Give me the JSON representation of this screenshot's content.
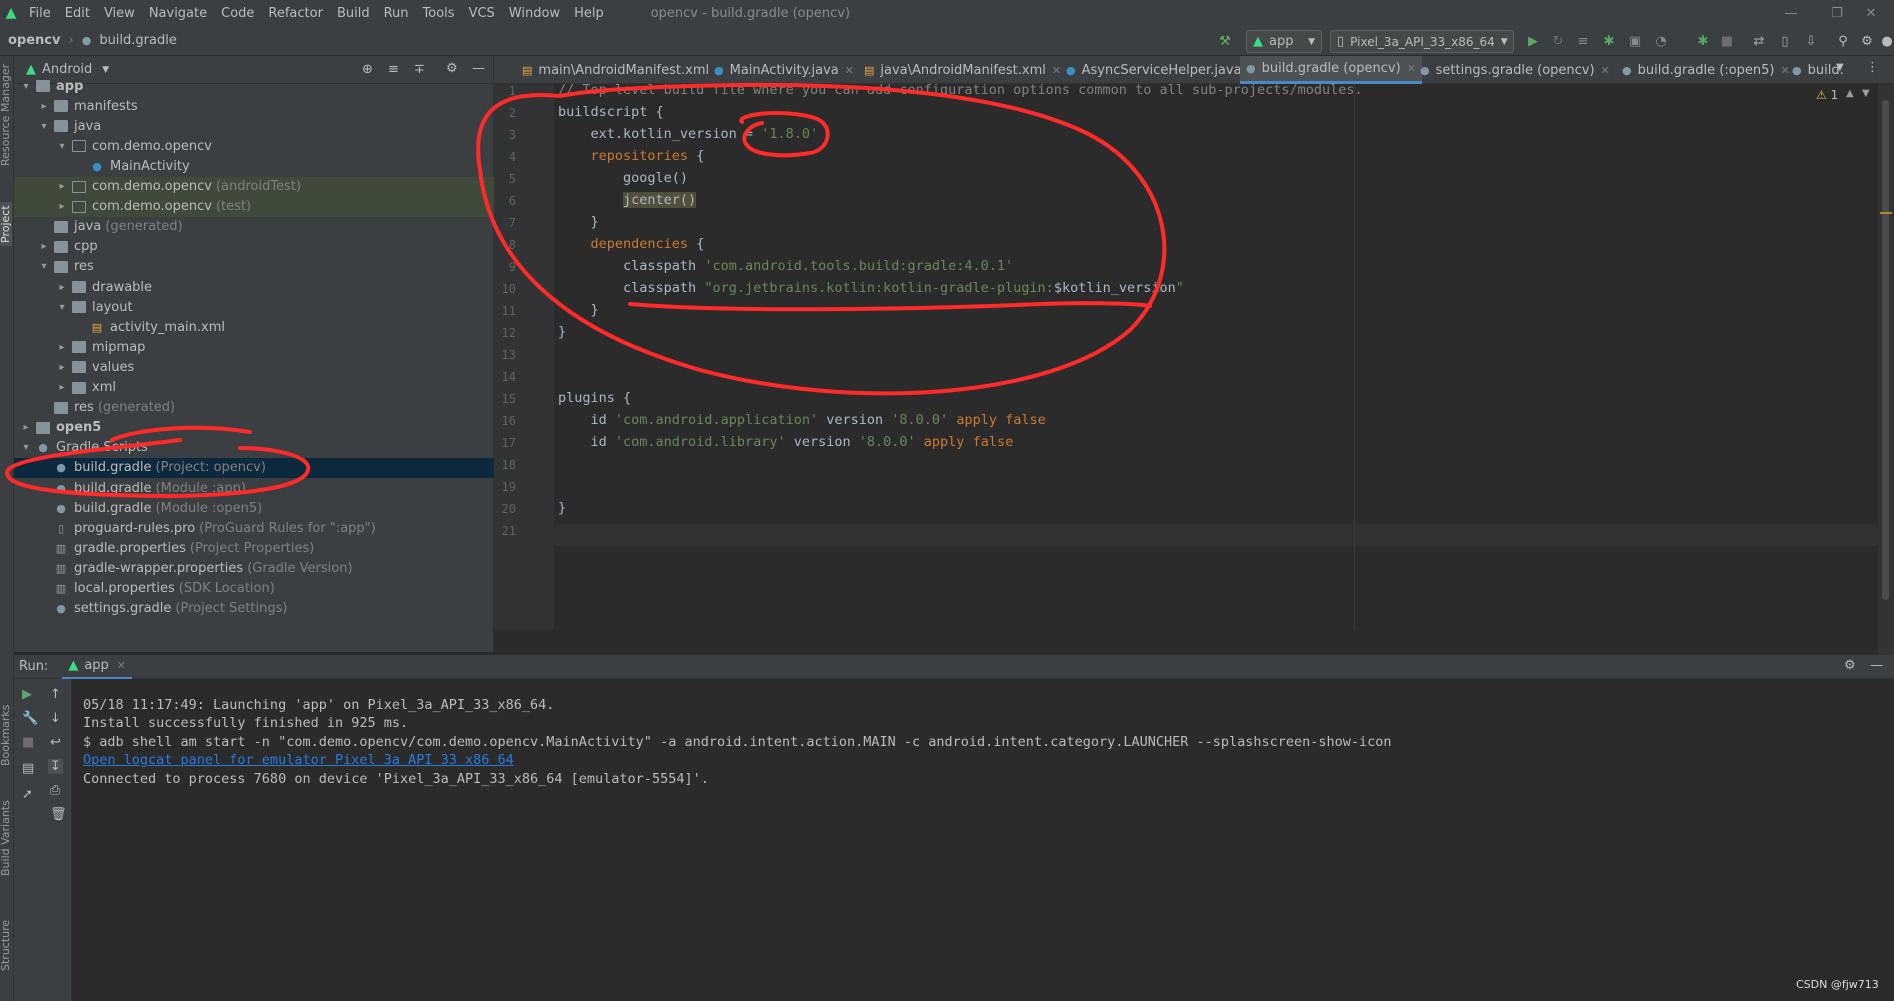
{
  "app": {
    "logo_icon": "android-studio-icon",
    "window_title": "opencv - build.gradle (opencv)"
  },
  "menu": [
    "File",
    "Edit",
    "View",
    "Navigate",
    "Code",
    "Refactor",
    "Build",
    "Run",
    "Tools",
    "VCS",
    "Window",
    "Help"
  ],
  "breadcrumb": {
    "project": "opencv",
    "file": "build.gradle"
  },
  "toolbar": {
    "run_config": "app",
    "device": "Pixel_3a_API_33_x86_64"
  },
  "left_stripe": {
    "resource_manager": "Resource Manager",
    "project": "Project",
    "bookmarks": "Bookmarks",
    "build_variants": "Build Variants",
    "structure": "Structure"
  },
  "project_panel": {
    "view_label": "Android",
    "tree": [
      {
        "label": "app",
        "suffix": "",
        "depth": 0,
        "expanded": true,
        "icon": "folder",
        "bold": true
      },
      {
        "label": "manifests",
        "suffix": "",
        "depth": 1,
        "expanded": false,
        "icon": "folder"
      },
      {
        "label": "java",
        "suffix": "",
        "depth": 1,
        "expanded": true,
        "icon": "folder"
      },
      {
        "label": "com.demo.opencv",
        "suffix": "",
        "depth": 2,
        "expanded": true,
        "icon": "package"
      },
      {
        "label": "MainActivity",
        "suffix": "",
        "depth": 3,
        "icon": "class"
      },
      {
        "label": "com.demo.opencv",
        "suffix": "(androidTest)",
        "depth": 2,
        "expanded": false,
        "icon": "package",
        "highlight": true
      },
      {
        "label": "com.demo.opencv",
        "suffix": "(test)",
        "depth": 2,
        "expanded": false,
        "icon": "package",
        "highlight": true
      },
      {
        "label": "java",
        "suffix": "(generated)",
        "depth": 1,
        "icon": "folder"
      },
      {
        "label": "cpp",
        "suffix": "",
        "depth": 1,
        "expanded": false,
        "icon": "folder"
      },
      {
        "label": "res",
        "suffix": "",
        "depth": 1,
        "expanded": true,
        "icon": "folder"
      },
      {
        "label": "drawable",
        "suffix": "",
        "depth": 2,
        "expanded": false,
        "icon": "folder"
      },
      {
        "label": "layout",
        "suffix": "",
        "depth": 2,
        "expanded": true,
        "icon": "folder"
      },
      {
        "label": "activity_main.xml",
        "suffix": "",
        "depth": 3,
        "icon": "xml"
      },
      {
        "label": "mipmap",
        "suffix": "",
        "depth": 2,
        "expanded": false,
        "icon": "folder"
      },
      {
        "label": "values",
        "suffix": "",
        "depth": 2,
        "expanded": false,
        "icon": "folder"
      },
      {
        "label": "xml",
        "suffix": "",
        "depth": 2,
        "expanded": false,
        "icon": "folder"
      },
      {
        "label": "res",
        "suffix": "(generated)",
        "depth": 1,
        "icon": "folder"
      },
      {
        "label": "open5",
        "suffix": "",
        "depth": 0,
        "expanded": false,
        "icon": "folder",
        "bold": true
      },
      {
        "label": "Gradle Scripts",
        "suffix": "",
        "depth": 0,
        "expanded": true,
        "icon": "gradle"
      },
      {
        "label": "build.gradle",
        "suffix": "(Project: opencv)",
        "depth": 1,
        "icon": "gradle",
        "selected": true
      },
      {
        "label": "build.gradle",
        "suffix": "(Module :app)",
        "depth": 1,
        "icon": "gradle"
      },
      {
        "label": "build.gradle",
        "suffix": "(Module :open5)",
        "depth": 1,
        "icon": "gradle"
      },
      {
        "label": "proguard-rules.pro",
        "suffix": "(ProGuard Rules for \":app\")",
        "depth": 1,
        "icon": "file"
      },
      {
        "label": "gradle.properties",
        "suffix": "(Project Properties)",
        "depth": 1,
        "icon": "props"
      },
      {
        "label": "gradle-wrapper.properties",
        "suffix": "(Gradle Version)",
        "depth": 1,
        "icon": "props"
      },
      {
        "label": "local.properties",
        "suffix": "(SDK Location)",
        "depth": 1,
        "icon": "props"
      },
      {
        "label": "settings.gradle",
        "suffix": "(Project Settings)",
        "depth": 1,
        "icon": "gradle"
      }
    ]
  },
  "tabs": [
    {
      "label": "main\\AndroidManifest.xml",
      "icon": "xml"
    },
    {
      "label": "MainActivity.java",
      "icon": "class"
    },
    {
      "label": "java\\AndroidManifest.xml",
      "icon": "xml"
    },
    {
      "label": "AsyncServiceHelper.java",
      "icon": "class"
    },
    {
      "label": "build.gradle (opencv)",
      "icon": "gradle",
      "active": true
    },
    {
      "label": "settings.gradle (opencv)",
      "icon": "gradle"
    },
    {
      "label": "build.gradle (:open5)",
      "icon": "gradle"
    },
    {
      "label": "build.",
      "icon": "gradle"
    }
  ],
  "editor": {
    "warnings": "1",
    "lines": [
      {
        "n": "1",
        "t": "// Top-level build file where you can add configuration options common to all sub-projects/modules."
      },
      {
        "n": "2",
        "t": "buildscript {"
      },
      {
        "n": "3",
        "t": "    ext.kotlin_version = '1.8.0'"
      },
      {
        "n": "4",
        "t": "    repositories {"
      },
      {
        "n": "5",
        "t": "        google()"
      },
      {
        "n": "6",
        "t": "        jcenter()"
      },
      {
        "n": "7",
        "t": "    }"
      },
      {
        "n": "8",
        "t": "    dependencies {"
      },
      {
        "n": "9",
        "t": "        classpath 'com.android.tools.build:gradle:4.0.1'"
      },
      {
        "n": "10",
        "t": "        classpath \"org.jetbrains.kotlin:kotlin-gradle-plugin:$kotlin_version\""
      },
      {
        "n": "11",
        "t": "    }"
      },
      {
        "n": "12",
        "t": "}"
      },
      {
        "n": "13",
        "t": ""
      },
      {
        "n": "14",
        "t": ""
      },
      {
        "n": "15",
        "t": "plugins {"
      },
      {
        "n": "16",
        "t": "    id 'com.android.application' version '8.0.0' apply false"
      },
      {
        "n": "17",
        "t": "    id 'com.android.library' version '8.0.0' apply false"
      },
      {
        "n": "18",
        "t": ""
      },
      {
        "n": "19",
        "t": ""
      },
      {
        "n": "20",
        "t": "}"
      },
      {
        "n": "21",
        "t": ""
      }
    ]
  },
  "run_panel": {
    "label": "Run:",
    "tab": "app",
    "console": [
      {
        "text": "05/18 11:17:49: Launching 'app' on Pixel_3a_API_33_x86_64."
      },
      {
        "text": "Install successfully finished in 925 ms."
      },
      {
        "text": "$ adb shell am start -n \"com.demo.opencv/com.demo.opencv.MainActivity\" -a android.intent.action.MAIN -c android.intent.category.LAUNCHER --splashscreen-show-icon"
      },
      {
        "text": "Open logcat panel for emulator Pixel 3a API 33 x86 64",
        "link": true
      },
      {
        "text": "Connected to process 7680 on device 'Pixel_3a_API_33_x86_64 [emulator-5554]'."
      }
    ]
  },
  "watermark": "CSDN @fjw713",
  "colors": {
    "accent": "#4a88c7",
    "annotation": "#ff2a2a",
    "keyword": "#cc7832",
    "string": "#6a8759"
  }
}
